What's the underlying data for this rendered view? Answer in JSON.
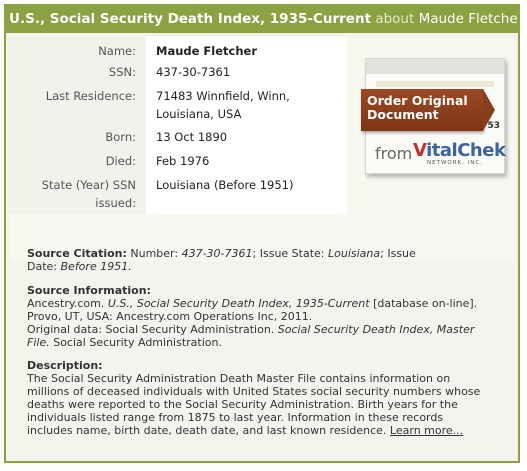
{
  "header": {
    "title": "U.S., Social Security Death Index, 1935-Current",
    "about": "about",
    "person": "Maude Fletcher"
  },
  "record": {
    "fields": [
      {
        "label": "Name:",
        "value": "Maude Fletcher"
      },
      {
        "label": "SSN:",
        "value": "437-30-7361"
      },
      {
        "label": "Last Residence:",
        "value": "71483  Winnfield, Winn,",
        "value2": "Louisiana, USA"
      },
      {
        "label": "Born:",
        "value": "13 Oct 1890"
      },
      {
        "label": "Died:",
        "value": "Feb 1976"
      },
      {
        "label": "State (Year) SSN",
        "label2": "issued:",
        "value": "Louisiana (Before 1951)"
      }
    ]
  },
  "order_doc": {
    "line1": "Order Original",
    "line2": "Document",
    "from": "from",
    "brand_v": "V",
    "brand_rest": "italChek",
    "network": "NETWORK, INC.",
    "corner": "53"
  },
  "source_citation": {
    "heading": "Source Citation:",
    "number_label": "Number:",
    "number": "437-30-7361",
    "state_label": "Issue State:",
    "state": "Louisiana",
    "issue_label": "Issue",
    "date_label": "Date:",
    "date": "Before 1951."
  },
  "source_info": {
    "heading": "Source Information:",
    "line1_pre": "Ancestry.com.",
    "line1_title": "U.S., Social Security Death Index, 1935-Current",
    "line1_post": "[database on-line].",
    "line2": "Provo, UT, USA: Ancestry.com Operations Inc, 2011.",
    "line3_pre": "Original data: Social Security Administration.",
    "line3_title": "Social Security Death Index, Master",
    "line4_title": "File.",
    "line4_post": "Social Security Administration."
  },
  "description": {
    "heading": "Description:",
    "lines": [
      "The Social Security Administration Death Master File contains information on",
      "millions of deceased individuals with United States social security numbers whose",
      "deaths were reported to the Social Security Administration. Birth years for the",
      "individuals listed range from 1875 to last year. Information in these records"
    ],
    "last_line": "includes name, birth date, death date, and last known residence.",
    "learn_more": "Learn more..."
  }
}
